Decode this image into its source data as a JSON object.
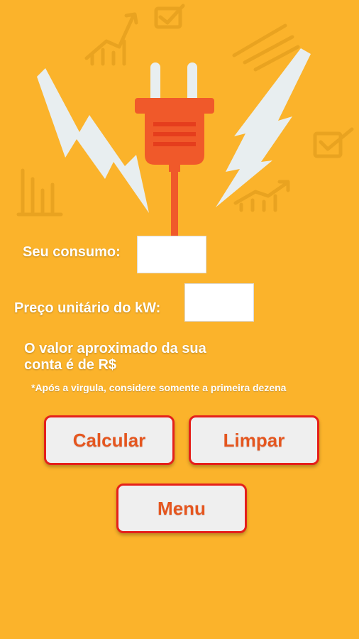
{
  "form": {
    "consumo_label": "Seu consumo:",
    "consumo_value": "",
    "preco_label": "Preço unitário do kW:",
    "preco_value": "",
    "result_line1": "O valor aproximado da sua",
    "result_line2": "conta é de R$",
    "note": "*Após a virgula, considere somente a primeira dezena"
  },
  "buttons": {
    "calcular": "Calcular",
    "limpar": "Limpar",
    "menu": "Menu"
  },
  "icons": [
    "electric-plug-icon",
    "lightning-bolt-icon",
    "chart-icon",
    "checkbox-icon",
    "bar-chart-icon"
  ],
  "colors": {
    "background": "#FBB32B",
    "plug": "#F0592A",
    "lightning": "#E8EEF0",
    "button_border": "#E5201B",
    "button_text": "#E5561F",
    "button_bg": "#EFEFEF"
  }
}
